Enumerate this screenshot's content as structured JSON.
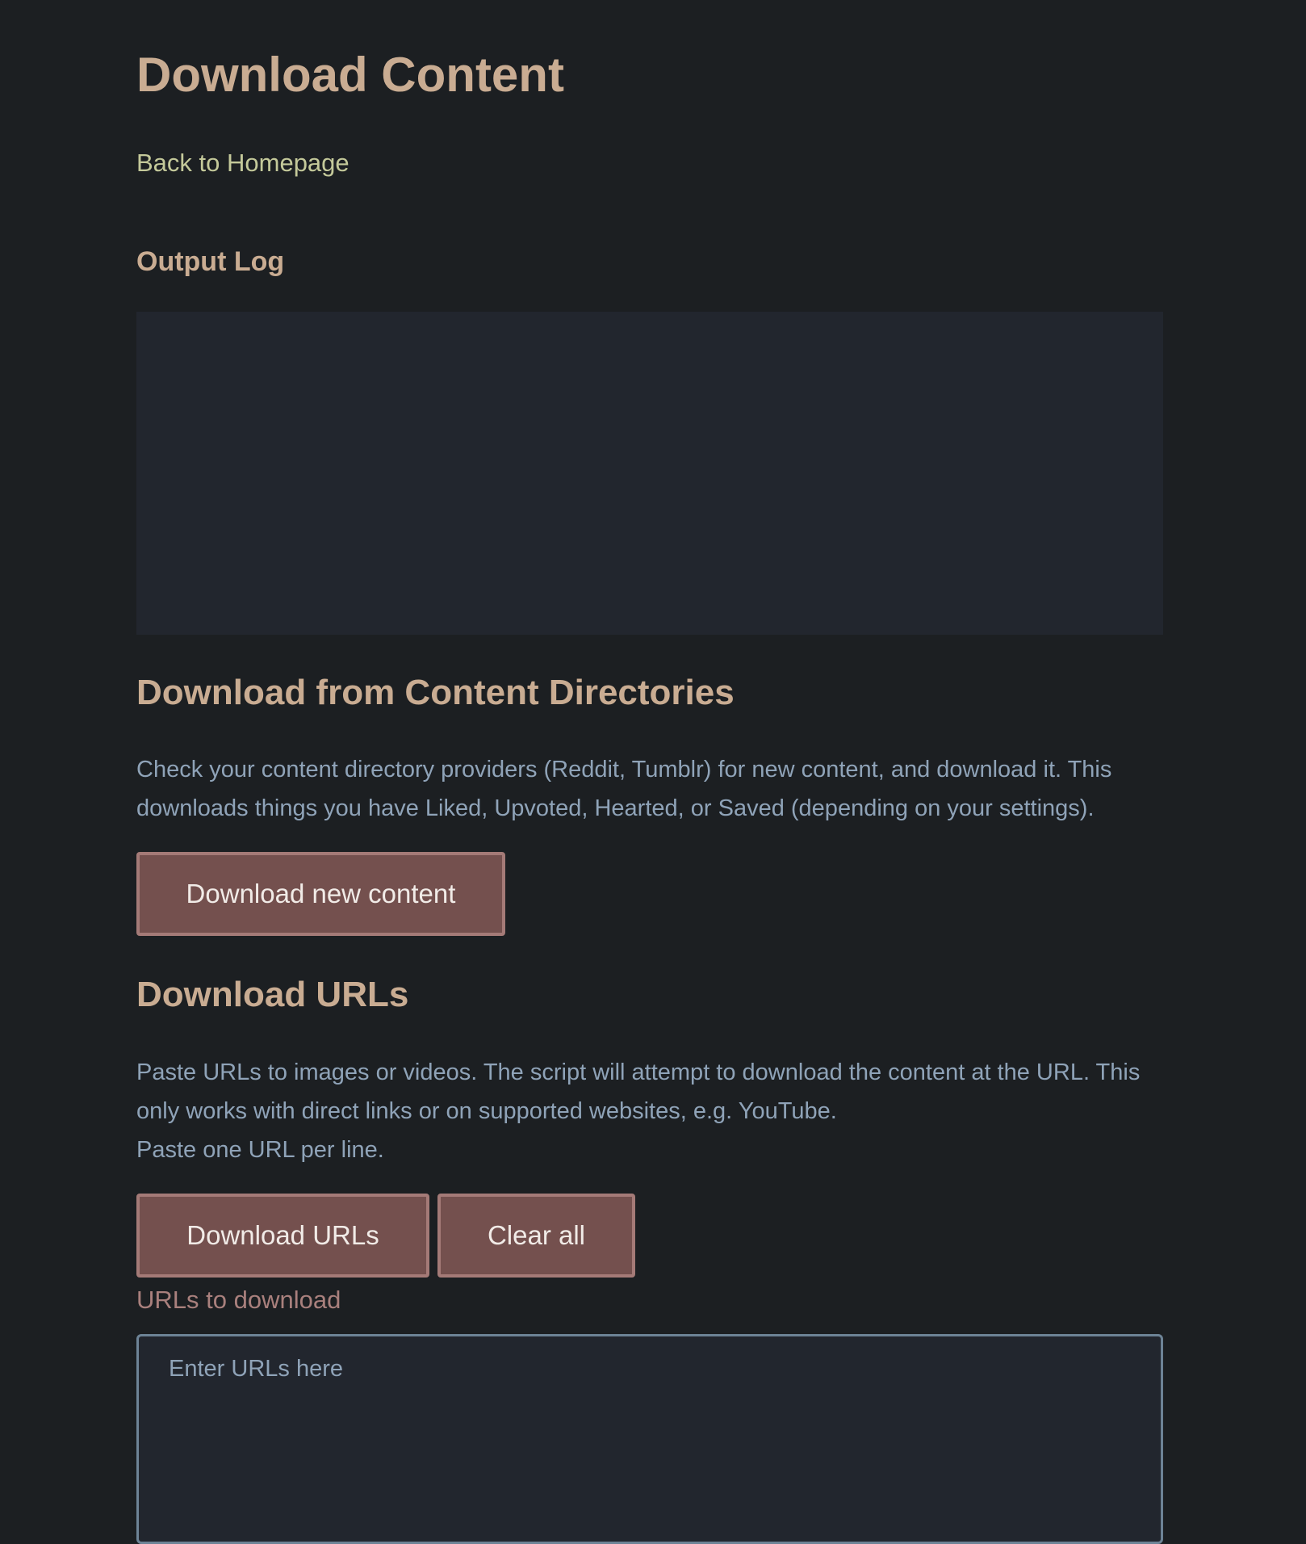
{
  "page": {
    "title": "Download Content",
    "back_link": "Back to Homepage"
  },
  "output_log": {
    "heading": "Output Log",
    "content": ""
  },
  "directories_section": {
    "heading": "Download from Content Directories",
    "description": "Check your content directory providers (Reddit, Tumblr) for new content, and download it. This downloads things you have Liked, Upvoted, Hearted, or Saved (depending on your settings).",
    "download_button": "Download new content"
  },
  "urls_section": {
    "heading": "Download URLs",
    "description_line1": "Paste URLs to images or videos. The script will attempt to download the content at the URL. This only works with direct links or on supported websites, e.g. YouTube.",
    "description_line2": "Paste one URL per line.",
    "download_button": "Download URLs",
    "clear_button": "Clear all",
    "input_label": "URLs to download",
    "input_placeholder": "Enter URLs here",
    "input_value": ""
  },
  "colors": {
    "background": "#1c1f22",
    "heading": "#c9ac92",
    "link": "#c4c99a",
    "body_text": "#8fa3b8",
    "panel": "#22262e",
    "button_bg": "#74504e",
    "button_border": "#a47a77",
    "label": "#a9807d"
  }
}
